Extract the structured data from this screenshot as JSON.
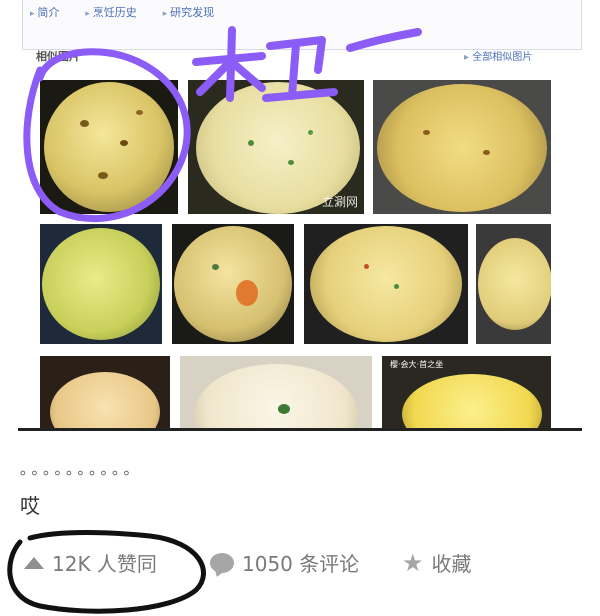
{
  "subnav": {
    "items": [
      "简介",
      "烹饪历史",
      "研究发现"
    ]
  },
  "related": {
    "title": "相似图片",
    "all_link": "全部相似图片"
  },
  "images": {
    "watermark": "立涮网",
    "caption": "樱·会大·首之坐"
  },
  "annotation": {
    "handwritten_text": "木卫一",
    "highlight_color": "#8b5cf6"
  },
  "post": {
    "dots": "。。。。。。。。。。",
    "text": "哎"
  },
  "actions": {
    "upvotes": "12K 人赞同",
    "comments": "1050 条评论",
    "favorite": "收藏"
  },
  "colors": {
    "link": "#4a6fb5",
    "icon_gray": "#a6a6a6",
    "ink": "#111111"
  }
}
